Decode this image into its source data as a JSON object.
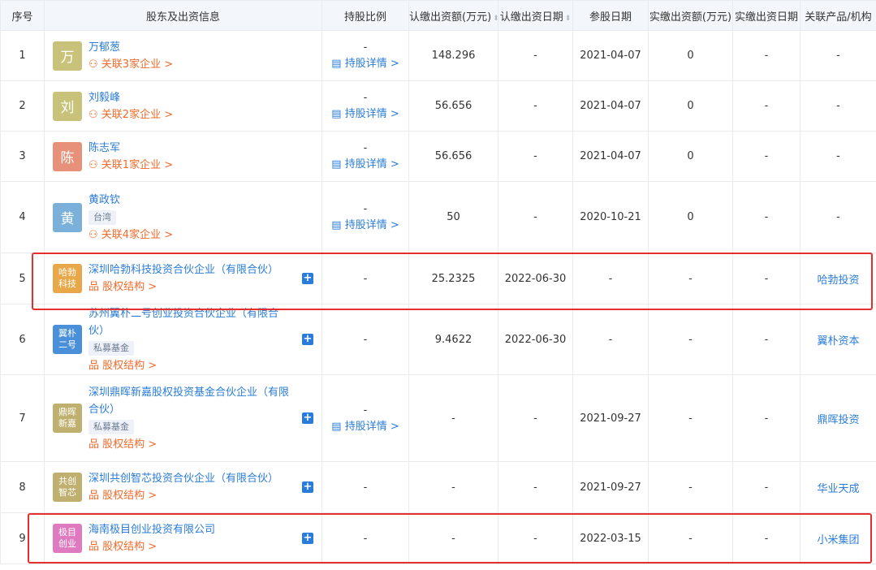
{
  "headers": [
    "序号",
    "股东及出资信息",
    "持股比例",
    "认缴出资额(万元)",
    "认缴出资日期",
    "参股日期",
    "实缴出资额(万元)",
    "实缴出资日期",
    "关联产品/机构"
  ],
  "sort_icon": "⬍",
  "detail_label": "持股详情 >",
  "colors": {
    "person_wan": "#c9c27a",
    "person_liu": "#c9c27a",
    "person_chen": "#e8917a",
    "person_huang": "#7ab0d9",
    "org_orange": "#e8a84a",
    "org_blue": "#4a90d9",
    "org_olive": "#c0b070",
    "org_pink": "#e07ac0"
  },
  "rows": [
    {
      "no": "1",
      "logo": "万",
      "name": "万郁葱",
      "tag": "",
      "link": "关联3家企业 >",
      "ratio": "-",
      "detail": true,
      "amount": "148.296",
      "sub_date": "-",
      "join_date": "2021-04-07",
      "paid": "0",
      "paid_date": "-",
      "product": "-"
    },
    {
      "no": "2",
      "logo": "刘",
      "name": "刘毅峰",
      "tag": "",
      "link": "关联2家企业 >",
      "ratio": "-",
      "detail": true,
      "amount": "56.656",
      "sub_date": "-",
      "join_date": "2021-04-07",
      "paid": "0",
      "paid_date": "-",
      "product": "-"
    },
    {
      "no": "3",
      "logo": "陈",
      "name": "陈志军",
      "tag": "",
      "link": "关联1家企业 >",
      "ratio": "-",
      "detail": true,
      "amount": "56.656",
      "sub_date": "-",
      "join_date": "2021-04-07",
      "paid": "0",
      "paid_date": "-",
      "product": "-"
    },
    {
      "no": "4",
      "logo": "黄",
      "name": "黄政钦",
      "tag": "台湾",
      "link": "关联4家企业 >",
      "ratio": "-",
      "detail": true,
      "amount": "50",
      "sub_date": "-",
      "join_date": "2020-10-21",
      "paid": "0",
      "paid_date": "-",
      "product": "-"
    },
    {
      "no": "5",
      "logo": "哈勃 科技",
      "name": "深圳哈勃科技投资合伙企业（有限合伙）",
      "tag": "",
      "link": "股权结构 >",
      "ratio": "-",
      "detail": false,
      "amount": "25.2325",
      "sub_date": "2022-06-30",
      "join_date": "-",
      "paid": "-",
      "paid_date": "-",
      "product": "哈勃投资"
    },
    {
      "no": "6",
      "logo": "翼朴 二号",
      "name": "苏州翼朴二号创业投资合伙企业（有限合伙）",
      "tag": "私募基金",
      "link": "股权结构 >",
      "ratio": "-",
      "detail": false,
      "amount": "9.4622",
      "sub_date": "2022-06-30",
      "join_date": "-",
      "paid": "-",
      "paid_date": "-",
      "product": "翼朴资本"
    },
    {
      "no": "7",
      "logo": "鼎晖 新嘉",
      "name": "深圳鼎晖新嘉股权投资基金合伙企业（有限合伙）",
      "tag": "私募基金",
      "link": "股权结构 >",
      "ratio": "-",
      "detail": true,
      "amount": "-",
      "sub_date": "-",
      "join_date": "2021-09-27",
      "paid": "-",
      "paid_date": "-",
      "product": "鼎晖投资"
    },
    {
      "no": "8",
      "logo": "共创 智芯",
      "name": "深圳共创智芯投资合伙企业（有限合伙）",
      "tag": "",
      "link": "股权结构 >",
      "ratio": "-",
      "detail": false,
      "amount": "-",
      "sub_date": "-",
      "join_date": "2021-09-27",
      "paid": "-",
      "paid_date": "-",
      "product": "华业天成"
    },
    {
      "no": "9",
      "logo": "极目 创业",
      "name": "海南极目创业投资有限公司",
      "tag": "",
      "link": "股权结构 >",
      "ratio": "-",
      "detail": false,
      "amount": "-",
      "sub_date": "-",
      "join_date": "2022-03-15",
      "paid": "-",
      "paid_date": "-",
      "product": "小米集团"
    }
  ]
}
